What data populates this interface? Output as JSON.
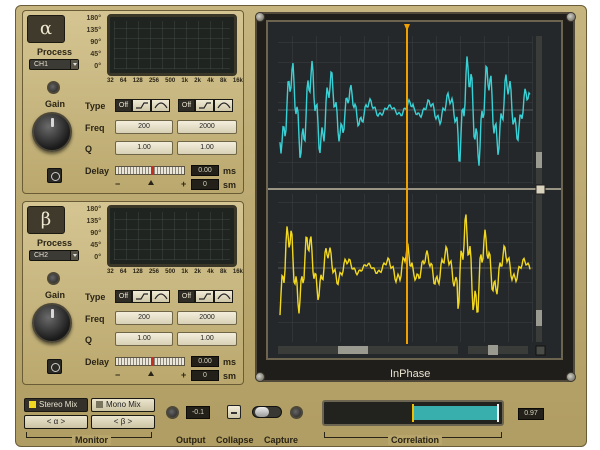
{
  "colors": {
    "wave_alpha": "#38d2d6",
    "wave_beta": "#f2d81e",
    "cursor": "#f0a000",
    "correlation": "#3cc7c7"
  },
  "degree_ticks": [
    "180°",
    "135°",
    "90°",
    "45°",
    "0°"
  ],
  "freq_ticks": [
    "32",
    "64",
    "128",
    "256",
    "500",
    "1k",
    "2k",
    "4k",
    "8k",
    "16k"
  ],
  "alpha": {
    "symbol": "α",
    "process_label": "Process",
    "channel": "CH1",
    "gain_label": "Gain",
    "type_label": "Type",
    "freq_label": "Freq",
    "q_label": "Q",
    "delay_label": "Delay",
    "type1": "Off",
    "type2": "Off",
    "freq1": "200",
    "freq2": "2000",
    "q1": "1.00",
    "q2": "1.00",
    "delay_ms": "0.00",
    "delay_ms_unit": "ms",
    "delay_sm": "0",
    "delay_sm_unit": "sm",
    "minus": "−",
    "plus": "+"
  },
  "beta": {
    "symbol": "β",
    "process_label": "Process",
    "channel": "CH2",
    "gain_label": "Gain",
    "type_label": "Type",
    "freq_label": "Freq",
    "q_label": "Q",
    "delay_label": "Delay",
    "type1": "Off",
    "type2": "Off",
    "freq1": "200",
    "freq2": "2000",
    "q1": "1.00",
    "q2": "1.00",
    "delay_ms": "0.00",
    "delay_ms_unit": "ms",
    "delay_sm": "0",
    "delay_sm_unit": "sm",
    "minus": "−",
    "plus": "+"
  },
  "scope": {
    "title": "InPhase"
  },
  "bottom": {
    "stereo_mix": "Stereo Mix",
    "mono_mix": "Mono Mix",
    "alpha_nav": "< α >",
    "beta_nav": "< β >",
    "monitor_label": "Monitor",
    "output_value": "-0.1",
    "output_label": "Output",
    "collapse_label": "Collapse",
    "capture_label": "Capture",
    "correlation_label": "Correlation",
    "correlation_value": "0.97"
  }
}
